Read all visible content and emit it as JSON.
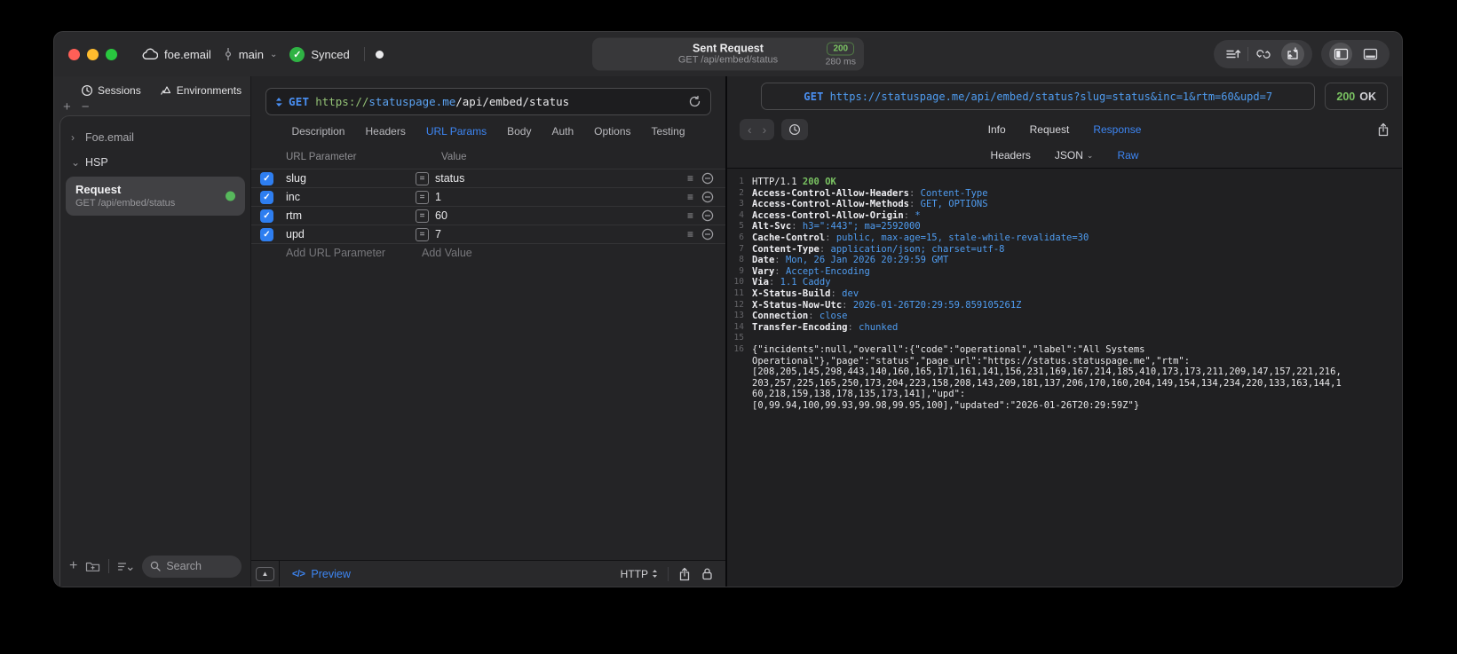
{
  "titlebar": {
    "project": "foe.email",
    "branch": "main",
    "sync_status": "Synced",
    "center": {
      "title": "Sent Request",
      "subtitle": "GET /api/embed/status",
      "status_code": "200",
      "duration": "280 ms"
    }
  },
  "sidebar": {
    "tabs": [
      {
        "label": "Sessions",
        "icon": "clock-icon",
        "active": true
      },
      {
        "label": "Environments",
        "icon": "environments-icon",
        "active": false
      }
    ],
    "tree": [
      {
        "type": "group",
        "label": "Foe.email",
        "expanded": false
      },
      {
        "type": "group",
        "label": "HSP",
        "expanded": true
      },
      {
        "type": "request",
        "label": "Request",
        "subtitle": "GET /api/embed/status",
        "selected": true
      }
    ],
    "search_placeholder": "Search"
  },
  "request_pane": {
    "method": "GET",
    "url": {
      "scheme": "https://",
      "host": "statuspage.me",
      "path": "/api/embed/status"
    },
    "tabs": [
      "Description",
      "Headers",
      "URL Params",
      "Body",
      "Auth",
      "Options",
      "Testing"
    ],
    "active_tab": "URL Params",
    "table": {
      "columns": [
        "URL Parameter",
        "Value"
      ],
      "rows": [
        {
          "checked": true,
          "name": "slug",
          "value": "status"
        },
        {
          "checked": true,
          "name": "inc",
          "value": "1"
        },
        {
          "checked": true,
          "name": "rtm",
          "value": "60"
        },
        {
          "checked": true,
          "name": "upd",
          "value": "7"
        }
      ],
      "add_name_placeholder": "Add URL Parameter",
      "add_value_placeholder": "Add Value"
    },
    "footer": {
      "preview_label": "Preview",
      "code_glyph": "</>",
      "protocol": "HTTP"
    }
  },
  "response_pane": {
    "method": "GET",
    "url": "https://statuspage.me/api/embed/status?slug=status&inc=1&rtm=60&upd=7",
    "status_code": "200",
    "status_text": "OK",
    "tabs": [
      "Info",
      "Request",
      "Response"
    ],
    "active_tab": "Response",
    "subtabs": [
      "Headers",
      "JSON",
      "Raw"
    ],
    "active_subtab": "Raw",
    "body_lines": [
      {
        "n": "1",
        "parts": [
          [
            "HTTP/1.1 ",
            "pw"
          ],
          [
            "200 OK",
            "pg"
          ]
        ]
      },
      {
        "n": "2",
        "parts": [
          [
            "Access-Control-Allow-Headers",
            "pk"
          ],
          [
            ": ",
            "pd"
          ],
          [
            "Content-Type",
            "pv"
          ]
        ]
      },
      {
        "n": "3",
        "parts": [
          [
            "Access-Control-Allow-Methods",
            "pk"
          ],
          [
            ": ",
            "pd"
          ],
          [
            "GET, OPTIONS",
            "pv"
          ]
        ]
      },
      {
        "n": "4",
        "parts": [
          [
            "Access-Control-Allow-Origin",
            "pk"
          ],
          [
            ": ",
            "pd"
          ],
          [
            "*",
            "pv"
          ]
        ]
      },
      {
        "n": "5",
        "parts": [
          [
            "Alt-Svc",
            "pk"
          ],
          [
            ": ",
            "pd"
          ],
          [
            "h3=\":443\"; ma=2592000",
            "pv"
          ]
        ]
      },
      {
        "n": "6",
        "parts": [
          [
            "Cache-Control",
            "pk"
          ],
          [
            ": ",
            "pd"
          ],
          [
            "public, max-age=15, stale-while-revalidate=30",
            "pv"
          ]
        ]
      },
      {
        "n": "7",
        "parts": [
          [
            "Content-Type",
            "pk"
          ],
          [
            ": ",
            "pd"
          ],
          [
            "application/json; charset=utf-8",
            "pv"
          ]
        ]
      },
      {
        "n": "8",
        "parts": [
          [
            "Date",
            "pk"
          ],
          [
            ": ",
            "pd"
          ],
          [
            "Mon, 26 Jan 2026 20:29:59 GMT",
            "pv"
          ]
        ]
      },
      {
        "n": "9",
        "parts": [
          [
            "Vary",
            "pk"
          ],
          [
            ": ",
            "pd"
          ],
          [
            "Accept-Encoding",
            "pv"
          ]
        ]
      },
      {
        "n": "10",
        "parts": [
          [
            "Via",
            "pk"
          ],
          [
            ": ",
            "pd"
          ],
          [
            "1.1 Caddy",
            "pv"
          ]
        ]
      },
      {
        "n": "11",
        "parts": [
          [
            "X-Status-Build",
            "pk"
          ],
          [
            ": ",
            "pd"
          ],
          [
            "dev",
            "pv"
          ]
        ]
      },
      {
        "n": "12",
        "parts": [
          [
            "X-Status-Now-Utc",
            "pk"
          ],
          [
            ": ",
            "pd"
          ],
          [
            "2026-01-26T20:29:59.859105261Z",
            "pv"
          ]
        ]
      },
      {
        "n": "13",
        "parts": [
          [
            "Connection",
            "pk"
          ],
          [
            ": ",
            "pd"
          ],
          [
            "close",
            "pv"
          ]
        ]
      },
      {
        "n": "14",
        "parts": [
          [
            "Transfer-Encoding",
            "pk"
          ],
          [
            ": ",
            "pd"
          ],
          [
            "chunked",
            "pv"
          ]
        ]
      },
      {
        "n": "15",
        "parts": []
      },
      {
        "n": "16",
        "parts": [
          [
            "{\"incidents\":null,\"overall\":{\"code\":\"operational\",\"label\":\"All Systems",
            "pw"
          ]
        ]
      },
      {
        "n": "",
        "parts": [
          [
            "Operational\"},\"page\":\"status\",\"page_url\":\"https://status.statuspage.me\",\"rtm\":",
            "pw"
          ]
        ]
      },
      {
        "n": "",
        "parts": [
          [
            "[208,205,145,298,443,140,160,165,171,161,141,156,231,169,167,214,185,410,173,173,211,209,147,157,221,216,",
            "pw"
          ]
        ]
      },
      {
        "n": "",
        "parts": [
          [
            "203,257,225,165,250,173,204,223,158,208,143,209,181,137,206,170,160,204,149,154,134,234,220,133,163,144,1",
            "pw"
          ]
        ]
      },
      {
        "n": "",
        "parts": [
          [
            "60,218,159,138,178,135,173,141],\"upd\":",
            "pw"
          ]
        ]
      },
      {
        "n": "",
        "parts": [
          [
            "[0,99.94,100,99.93,99.98,99.95,100],\"updated\":\"2026-01-26T20:29:59Z\"}",
            "pw"
          ]
        ]
      }
    ]
  },
  "colors": {
    "accent_blue": "#3d86f4",
    "status_green": "#7ac362",
    "checkbox_blue": "#2e7ef0",
    "traffic_red": "#ff5f57",
    "traffic_yellow": "#febc2e",
    "traffic_green": "#29c73f"
  }
}
